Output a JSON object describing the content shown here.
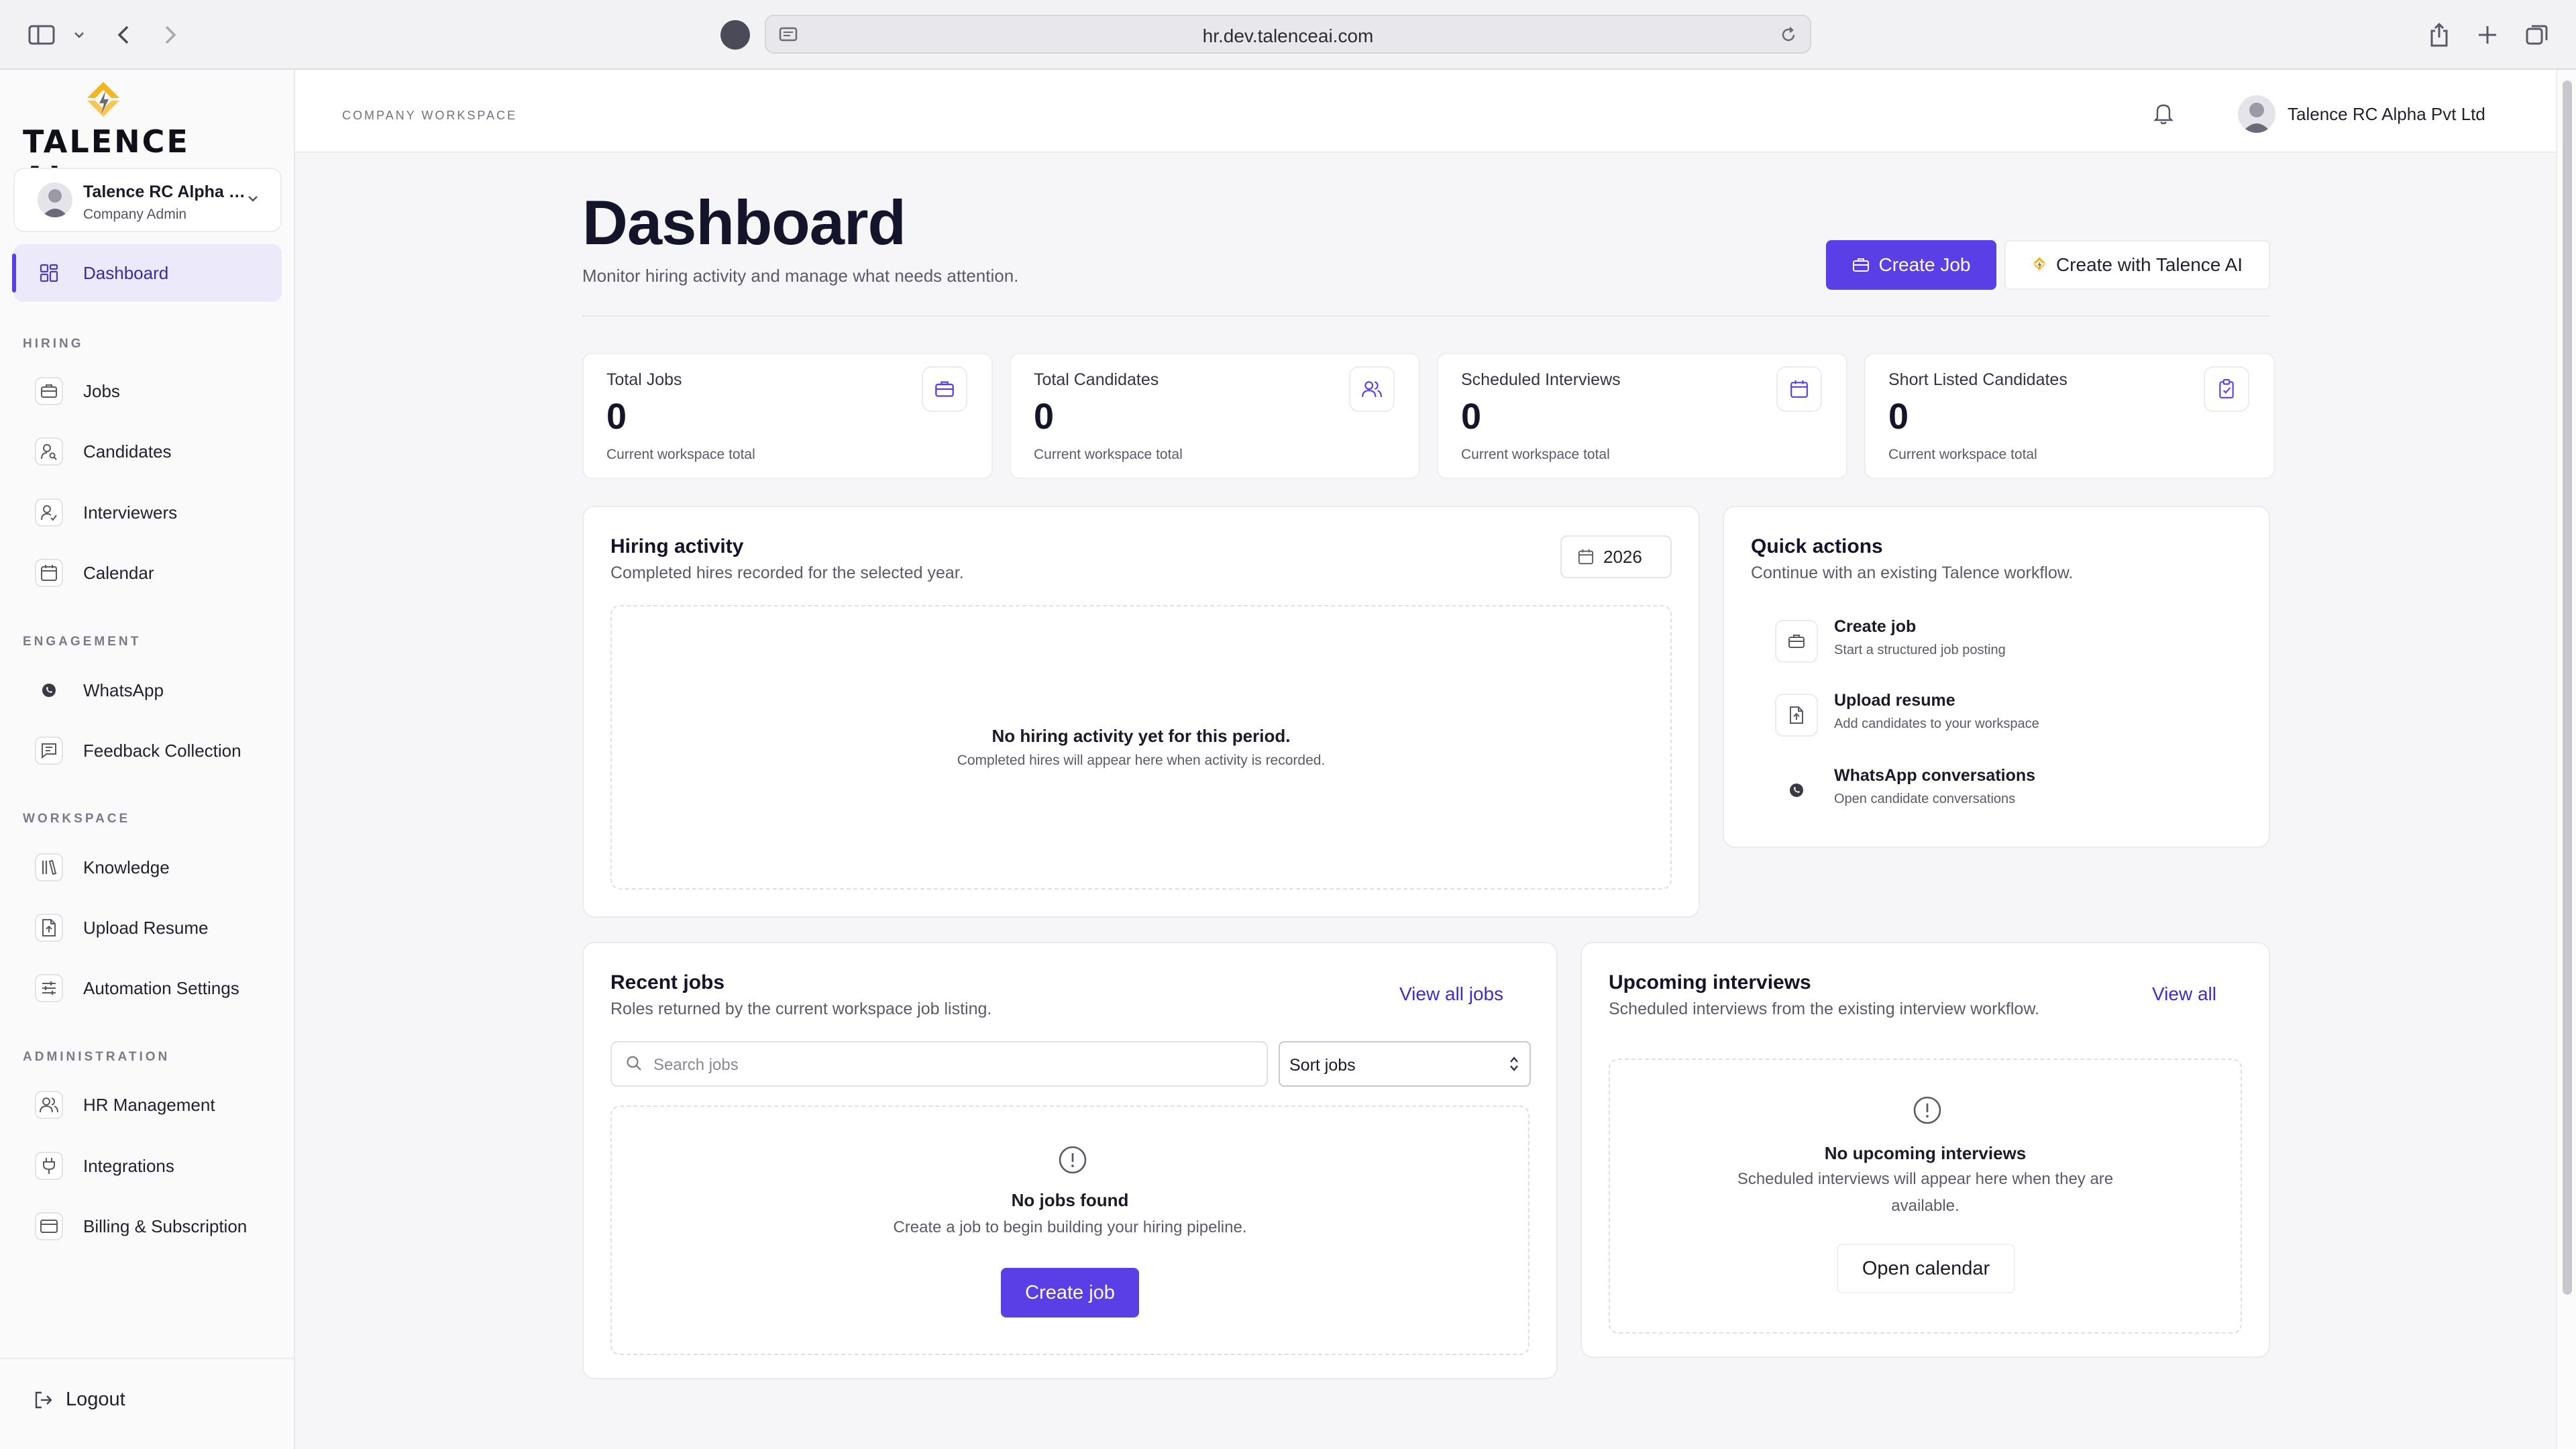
{
  "browser": {
    "url": "hr.dev.talenceai.com"
  },
  "brand": {
    "logo_text": "TALENCE AI",
    "accent": "#5b3fe6",
    "logo_color": "#f4b51e"
  },
  "org": {
    "name": "Talence RC Alpha P...",
    "role": "Company Admin"
  },
  "sidebar": {
    "dashboard": "Dashboard",
    "sections": {
      "hiring": "HIRING",
      "engagement": "ENGAGEMENT",
      "workspace": "WORKSPACE",
      "administration": "ADMINISTRATION"
    },
    "items": {
      "jobs": "Jobs",
      "candidates": "Candidates",
      "interviewers": "Interviewers",
      "calendar": "Calendar",
      "whatsapp": "WhatsApp",
      "feedback": "Feedback Collection",
      "knowledge": "Knowledge",
      "upload_resume": "Upload Resume",
      "automation": "Automation Settings",
      "hr": "HR Management",
      "integrations": "Integrations",
      "billing": "Billing & Subscription"
    },
    "logout": "Logout"
  },
  "topbar": {
    "breadcrumb": "COMPANY WORKSPACE",
    "user_name": "Talence RC Alpha Pvt Ltd"
  },
  "page": {
    "title": "Dashboard",
    "subtitle": "Monitor hiring activity and manage what needs attention.",
    "create_job": "Create Job",
    "create_ai": "Create with Talence AI"
  },
  "stats": [
    {
      "label": "Total Jobs",
      "value": "0",
      "note": "Current workspace total"
    },
    {
      "label": "Total Candidates",
      "value": "0",
      "note": "Current workspace total"
    },
    {
      "label": "Scheduled Interviews",
      "value": "0",
      "note": "Current workspace total"
    },
    {
      "label": "Short Listed Candidates",
      "value": "0",
      "note": "Current workspace total"
    }
  ],
  "hiring_activity": {
    "title": "Hiring activity",
    "subtitle": "Completed hires recorded for the selected year.",
    "year": "2026",
    "empty_title": "No hiring activity yet for this period.",
    "empty_sub": "Completed hires will appear here when activity is recorded."
  },
  "quick_actions": {
    "title": "Quick actions",
    "subtitle": "Continue with an existing Talence workflow.",
    "items": [
      {
        "title": "Create job",
        "sub": "Start a structured job posting"
      },
      {
        "title": "Upload resume",
        "sub": "Add candidates to your workspace"
      },
      {
        "title": "WhatsApp conversations",
        "sub": "Open candidate conversations"
      }
    ]
  },
  "recent_jobs": {
    "title": "Recent jobs",
    "subtitle": "Roles returned by the current workspace job listing.",
    "view_all": "View all jobs",
    "search_placeholder": "Search jobs",
    "sort_value": "Sort jobs",
    "empty_title": "No jobs found",
    "empty_sub": "Create a job to begin building your hiring pipeline.",
    "cta": "Create job"
  },
  "upcoming": {
    "title": "Upcoming interviews",
    "subtitle": "Scheduled interviews from the existing interview workflow.",
    "view_all": "View all",
    "empty_title": "No upcoming interviews",
    "empty_sub_1": "Scheduled interviews will appear here when they are",
    "empty_sub_2": "available.",
    "cta": "Open calendar"
  }
}
